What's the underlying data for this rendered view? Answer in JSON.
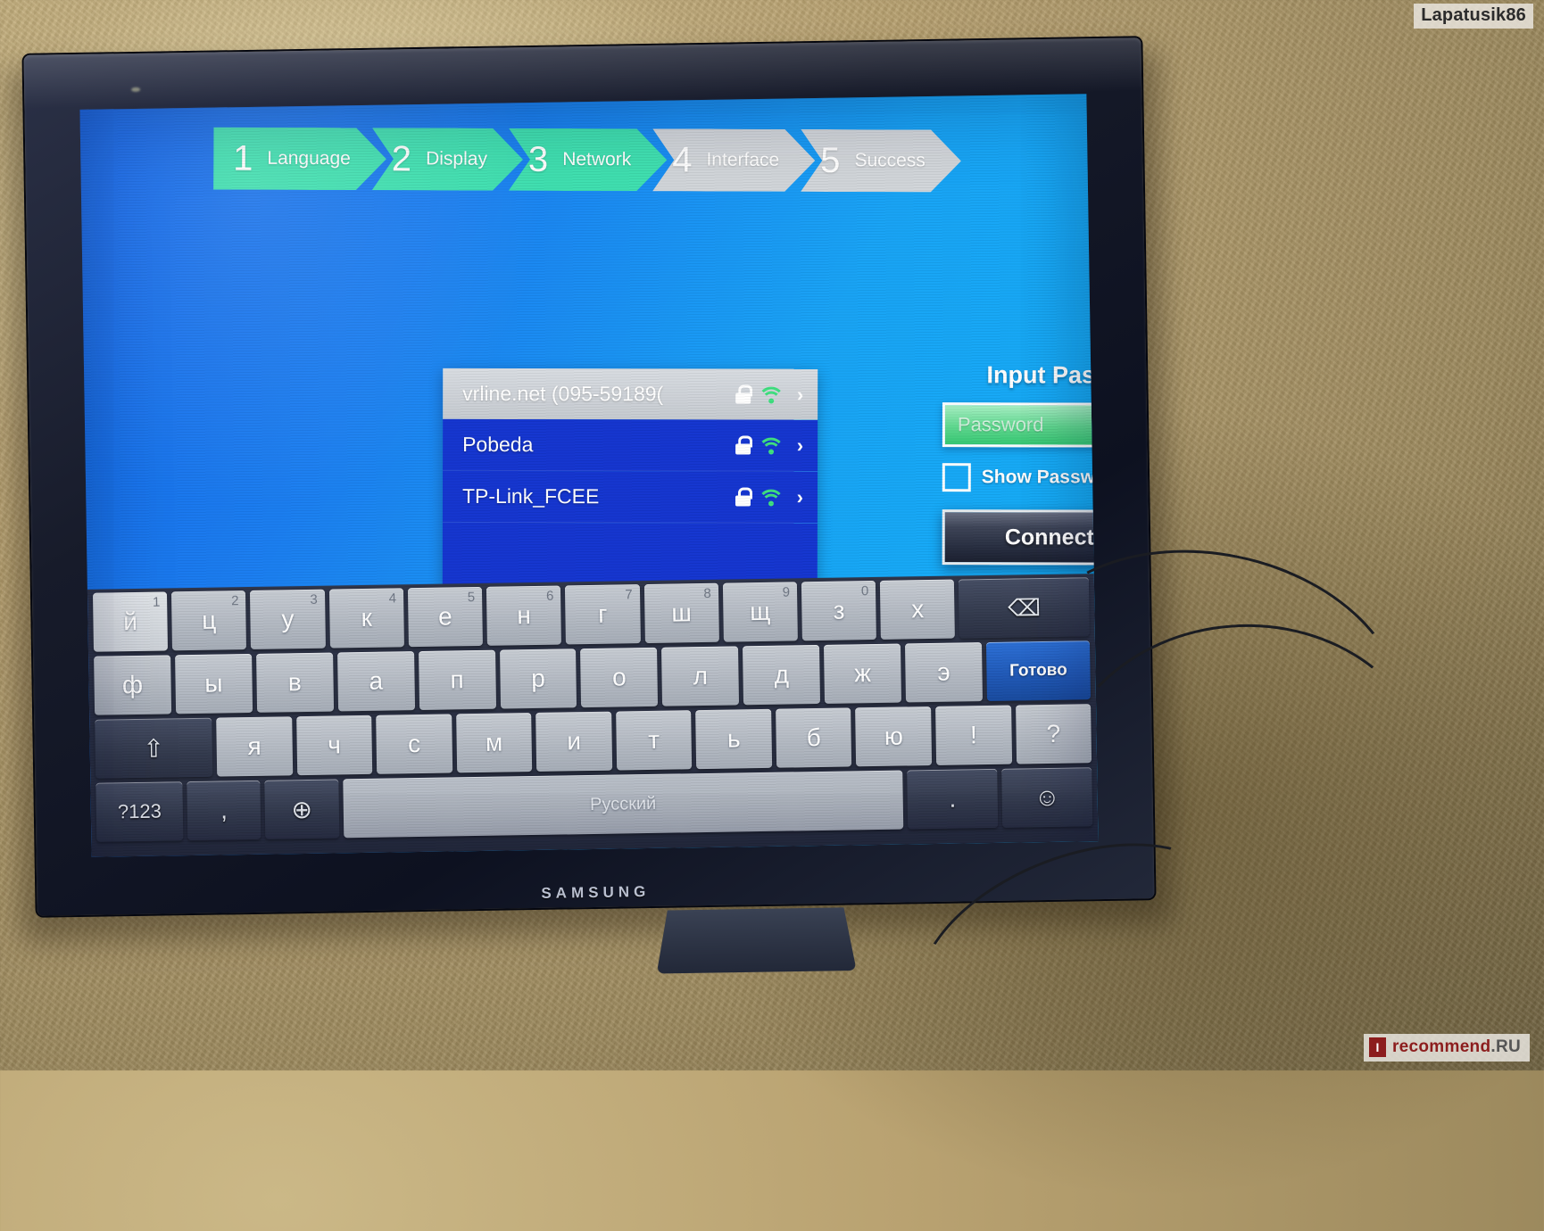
{
  "watermarks": {
    "top_right": "Lapatusik86",
    "bottom_mark": "I",
    "bottom_brand": "recommend",
    "bottom_tld": ".RU"
  },
  "tv": {
    "brand": "SAMSUNG"
  },
  "setup_wizard": {
    "steps": [
      {
        "number": "1",
        "label": "Language",
        "state": "done"
      },
      {
        "number": "2",
        "label": "Display",
        "state": "done"
      },
      {
        "number": "3",
        "label": "Network",
        "state": "done"
      },
      {
        "number": "4",
        "label": "Interface",
        "state": "todo"
      },
      {
        "number": "5",
        "label": "Success",
        "state": "todo"
      }
    ],
    "colors": {
      "step_done": "#3fe0b0",
      "step_todo": "#d2d6da",
      "screen_bg_left": "#1464e6",
      "screen_bg_right": "#12b0f7",
      "wifi_green": "#3ee07f",
      "password_field_green": "#5fd98f"
    }
  },
  "network_list": {
    "networks": [
      {
        "ssid": "vrline.net (095-59189(",
        "secured": true,
        "signal": "strong",
        "selected": true
      },
      {
        "ssid": "Pobeda",
        "secured": true,
        "signal": "strong",
        "selected": false
      },
      {
        "ssid": "TP-Link_FCEE",
        "secured": true,
        "signal": "strong",
        "selected": false
      }
    ],
    "chevron": "›"
  },
  "password_panel": {
    "title": "Input Password",
    "placeholder": "Password",
    "show_password_label": "Show Password",
    "show_password_checked": false,
    "connect_label": "Connect Now"
  },
  "keyboard": {
    "language_label": "Русский",
    "row1": [
      {
        "key": "й",
        "sup": "1",
        "style": "light"
      },
      {
        "key": "ц",
        "sup": "2",
        "style": "normal"
      },
      {
        "key": "у",
        "sup": "3",
        "style": "normal"
      },
      {
        "key": "к",
        "sup": "4",
        "style": "normal"
      },
      {
        "key": "е",
        "sup": "5",
        "style": "normal"
      },
      {
        "key": "н",
        "sup": "6",
        "style": "normal"
      },
      {
        "key": "г",
        "sup": "7",
        "style": "normal"
      },
      {
        "key": "ш",
        "sup": "8",
        "style": "normal"
      },
      {
        "key": "щ",
        "sup": "9",
        "style": "normal"
      },
      {
        "key": "з",
        "sup": "0",
        "style": "normal"
      },
      {
        "key": "х",
        "sup": "",
        "style": "normal"
      }
    ],
    "backspace_label": "⌫",
    "row2": [
      {
        "key": "ф"
      },
      {
        "key": "ы"
      },
      {
        "key": "в"
      },
      {
        "key": "а"
      },
      {
        "key": "п"
      },
      {
        "key": "р"
      },
      {
        "key": "о"
      },
      {
        "key": "л"
      },
      {
        "key": "д"
      },
      {
        "key": "ж"
      },
      {
        "key": "э"
      }
    ],
    "done_label": "Готово",
    "shift_label": "⇧",
    "row3": [
      {
        "key": "я"
      },
      {
        "key": "ч"
      },
      {
        "key": "с"
      },
      {
        "key": "м"
      },
      {
        "key": "и"
      },
      {
        "key": "т"
      },
      {
        "key": "ь"
      },
      {
        "key": "б"
      },
      {
        "key": "ю"
      },
      {
        "key": "!"
      },
      {
        "key": "?"
      }
    ],
    "row4": {
      "numbers_label": "?123",
      "comma_label": ",",
      "globe_label": "⊕",
      "period_label": ".",
      "emoji_label": "☺"
    }
  }
}
